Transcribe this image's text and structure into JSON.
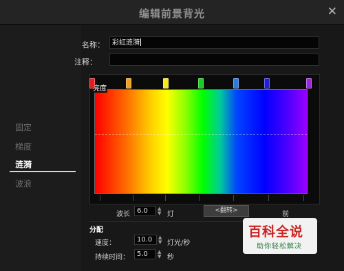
{
  "window": {
    "title": "编辑前景背光",
    "close_icon": "close-icon"
  },
  "sidebar": {
    "items": [
      {
        "label": "固定",
        "active": false
      },
      {
        "label": "梯度",
        "active": false
      },
      {
        "label": "涟漪",
        "active": true
      },
      {
        "label": "波浪",
        "active": false
      }
    ]
  },
  "form": {
    "name_label": "名称：",
    "name_value": "彩虹涟漪",
    "note_label": "注释：",
    "note_value": ""
  },
  "gradient": {
    "brightness_label": "亮度",
    "stops": [
      "#e02020",
      "#f0a020",
      "#f5e81c",
      "#1ccc1c",
      "#2a7ae0",
      "#2020d8",
      "#9a28d8"
    ]
  },
  "controls": {
    "wavelength_label": "波长",
    "wavelength_value": "6.0",
    "wavelength_unit": "灯",
    "flip_button": "<翻转>",
    "direction_label": "前"
  },
  "distribution": {
    "section_title": "分配",
    "speed_label": "速度：",
    "speed_value": "10.0",
    "speed_unit": "灯光/秒",
    "duration_label": "持续时间：",
    "duration_value": "5.0",
    "duration_unit": "秒"
  },
  "watermark": {
    "main": "百科全说",
    "sub": "助你轻松解决"
  }
}
